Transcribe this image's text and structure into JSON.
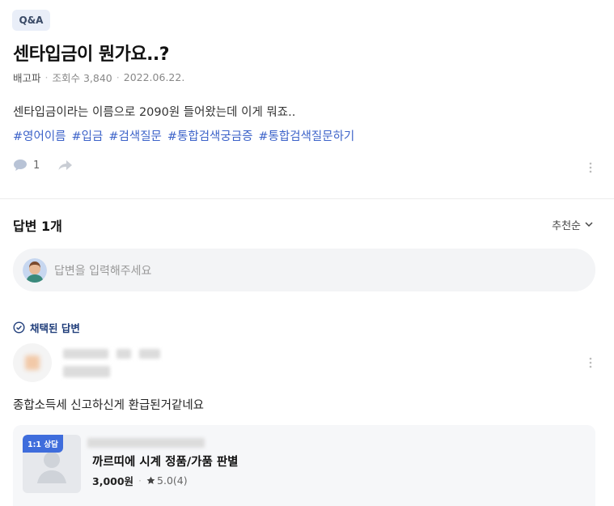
{
  "question": {
    "badge": "Q&A",
    "title": "센타입금이 뭔가요..?",
    "author": "배고파",
    "views": "조회수 3,840",
    "date": "2022.06.22.",
    "body": "센타입금이라는 이름으로 2090원 들어왔는데 이게 뭐죠..",
    "tags": [
      "#영어이름",
      "#입금",
      "#검색질문",
      "#통합검색궁금증",
      "#통합검색질문하기"
    ],
    "comment_count": "1"
  },
  "answers": {
    "title": "답변 1개",
    "sort_label": "추천순",
    "input_placeholder": "답변을 입력해주세요",
    "selected_label": "채택된 답변",
    "items": [
      {
        "text": "종합소득세 신고하신게 환급된거같네요"
      }
    ]
  },
  "promo_card": {
    "badge": "1:1 상담",
    "title": "까르띠에 시계 정품/가품 판별",
    "price": "3,000원",
    "rating": "5.0(4)"
  },
  "colors": {
    "tag": "#3d63c9",
    "accent": "#3f6ddc",
    "selected": "#1f3d7a"
  }
}
